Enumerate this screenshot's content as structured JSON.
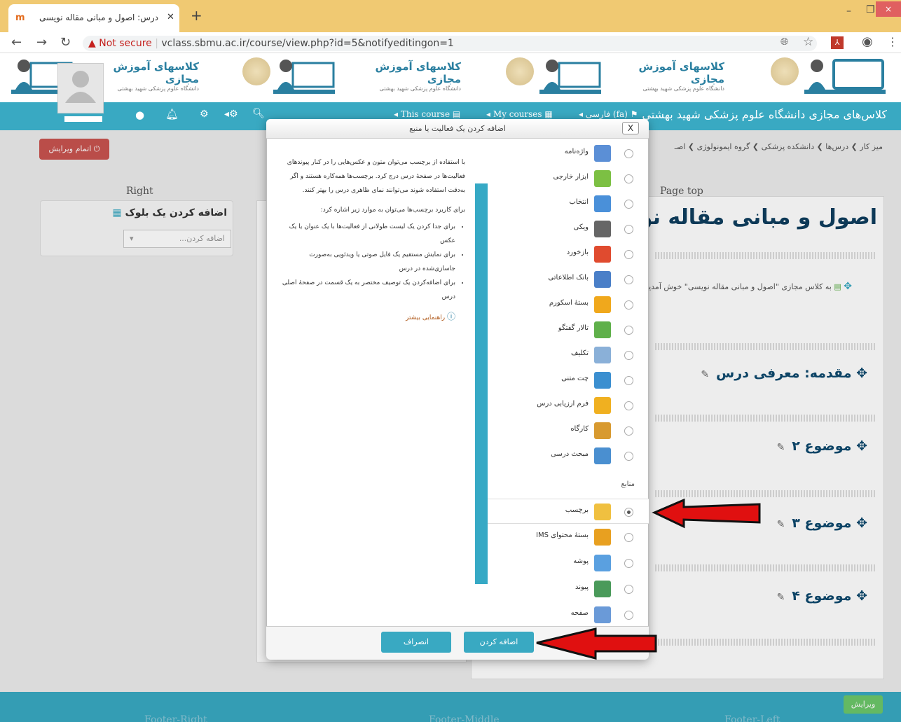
{
  "browser": {
    "tab_title": "درس: اصول و مبانی مقاله نویسی",
    "new_tab": "+",
    "not_secure": "Not secure",
    "url": "vclass.sbmu.ac.ir/course/view.php?id=5&notifyeditingon=1"
  },
  "banner": {
    "logo_title": "کلاسهای آموزش مجازی",
    "logo_subtitle": "دانشگاه علوم پزشکی شهید بهشتی"
  },
  "navbar": {
    "site_title": "کلاس‌های مجازی دانشگاه علوم پزشکی شهید بهشتی",
    "language": "فارسی (fa)",
    "my_courses": "My courses",
    "this_course": "This course"
  },
  "breadcrumb": "میز کار ❯ درس‌ها ❯ دانشکده پزشکی ❯ گروه ایمونولوژی ❯ اصـ",
  "edit_button": "اتمام ویرایش",
  "regions": {
    "right": "Right",
    "page_top": "Page top"
  },
  "block": {
    "title": "اضافه کردن یک بلوک",
    "select_placeholder": "اضافه کردن..."
  },
  "course": {
    "title": "اصول و مبانی مقاله نویسی",
    "welcome": "به کلاس مجازی \"اصول و مبانی مقاله نویسی\" خوش آمدید.",
    "sections": [
      "مقدمه: معرفی درس",
      "موضوع ۲",
      "موضوع ۳",
      "موضوع ۴"
    ]
  },
  "modal": {
    "title": "اضافه کردن یک فعالیت یا منبع",
    "close": "X",
    "activities": [
      {
        "label": "واژه‌نامه",
        "icon": "glossary-icon",
        "color": "#5b8fd6"
      },
      {
        "label": "ابزار خارجی",
        "icon": "puzzle-icon",
        "color": "#7cc043"
      },
      {
        "label": "انتخاب",
        "icon": "question-icon",
        "color": "#4a90d9"
      },
      {
        "label": "ویکی",
        "icon": "wiki-icon",
        "color": "#666666"
      },
      {
        "label": "بازخورد",
        "icon": "megaphone-icon",
        "color": "#e04b2f"
      },
      {
        "label": "بانک اطلاعاتی",
        "icon": "database-icon",
        "color": "#4a7fc8"
      },
      {
        "label": "بستهٔ اسکورم",
        "icon": "package-icon",
        "color": "#f0a81c"
      },
      {
        "label": "تالار گفتگو",
        "icon": "forum-icon",
        "color": "#5fb04a"
      },
      {
        "label": "تکلیف",
        "icon": "assignment-icon",
        "color": "#8ab0d8"
      },
      {
        "label": "چت متنی",
        "icon": "chat-icon",
        "color": "#3b8fd0"
      },
      {
        "label": "فرم ارزیابی درس",
        "icon": "survey-icon",
        "color": "#f0b020"
      },
      {
        "label": "کارگاه",
        "icon": "workshop-icon",
        "color": "#d89a30"
      },
      {
        "label": "مبحث درسی",
        "icon": "lesson-icon",
        "color": "#4a8fd0"
      }
    ],
    "resources_label": "منابع",
    "resources": [
      {
        "label": "برچسب",
        "icon": "label-tag-icon",
        "color": "#f0c040",
        "selected": true
      },
      {
        "label": "بستهٔ محتوای IMS",
        "icon": "ims-package-icon",
        "color": "#e8a020"
      },
      {
        "label": "پوشه",
        "icon": "folder-icon",
        "color": "#5aa0e0"
      },
      {
        "label": "پیوند",
        "icon": "url-icon",
        "color": "#4a9a5a"
      },
      {
        "label": "صفحه",
        "icon": "page-icon",
        "color": "#6a9ad8"
      }
    ],
    "help": {
      "intro": "با استفاده از برچسب می‌توان متون و عکس‌هایی را در کنار پیوندهای فعالیت‌ها در صفحهٔ درس درج کرد. برچسب‌ها همه‌کاره هستند و اگر به‌دقت استفاده شوند می‌توانند نمای ظاهری درس را بهتر کنند.",
      "uses_intro": "برای کاربرد برچسب‌ها می‌توان به موارد زیر اشاره کرد:",
      "uses": [
        "برای جدا کردن یک لیست طولانی از فعالیت‌ها با یک عنوان یا یک عکس",
        "برای نمایش مستقیم یک فایل صوتی یا ویدئویی به‌صورت جاسازی‌شده در درس",
        "برای اضافه‌کردن یک توصیف مختصر به یک قسمت در صفحهٔ اصلی درس"
      ],
      "more": "راهنمایی بیشتر"
    },
    "add_button": "اضافه کردن",
    "cancel_button": "انصراف"
  },
  "footer": {
    "right": "Footer-Right",
    "middle": "Footer-Middle",
    "left": "Footer-Left",
    "edit": "ویرایش"
  }
}
